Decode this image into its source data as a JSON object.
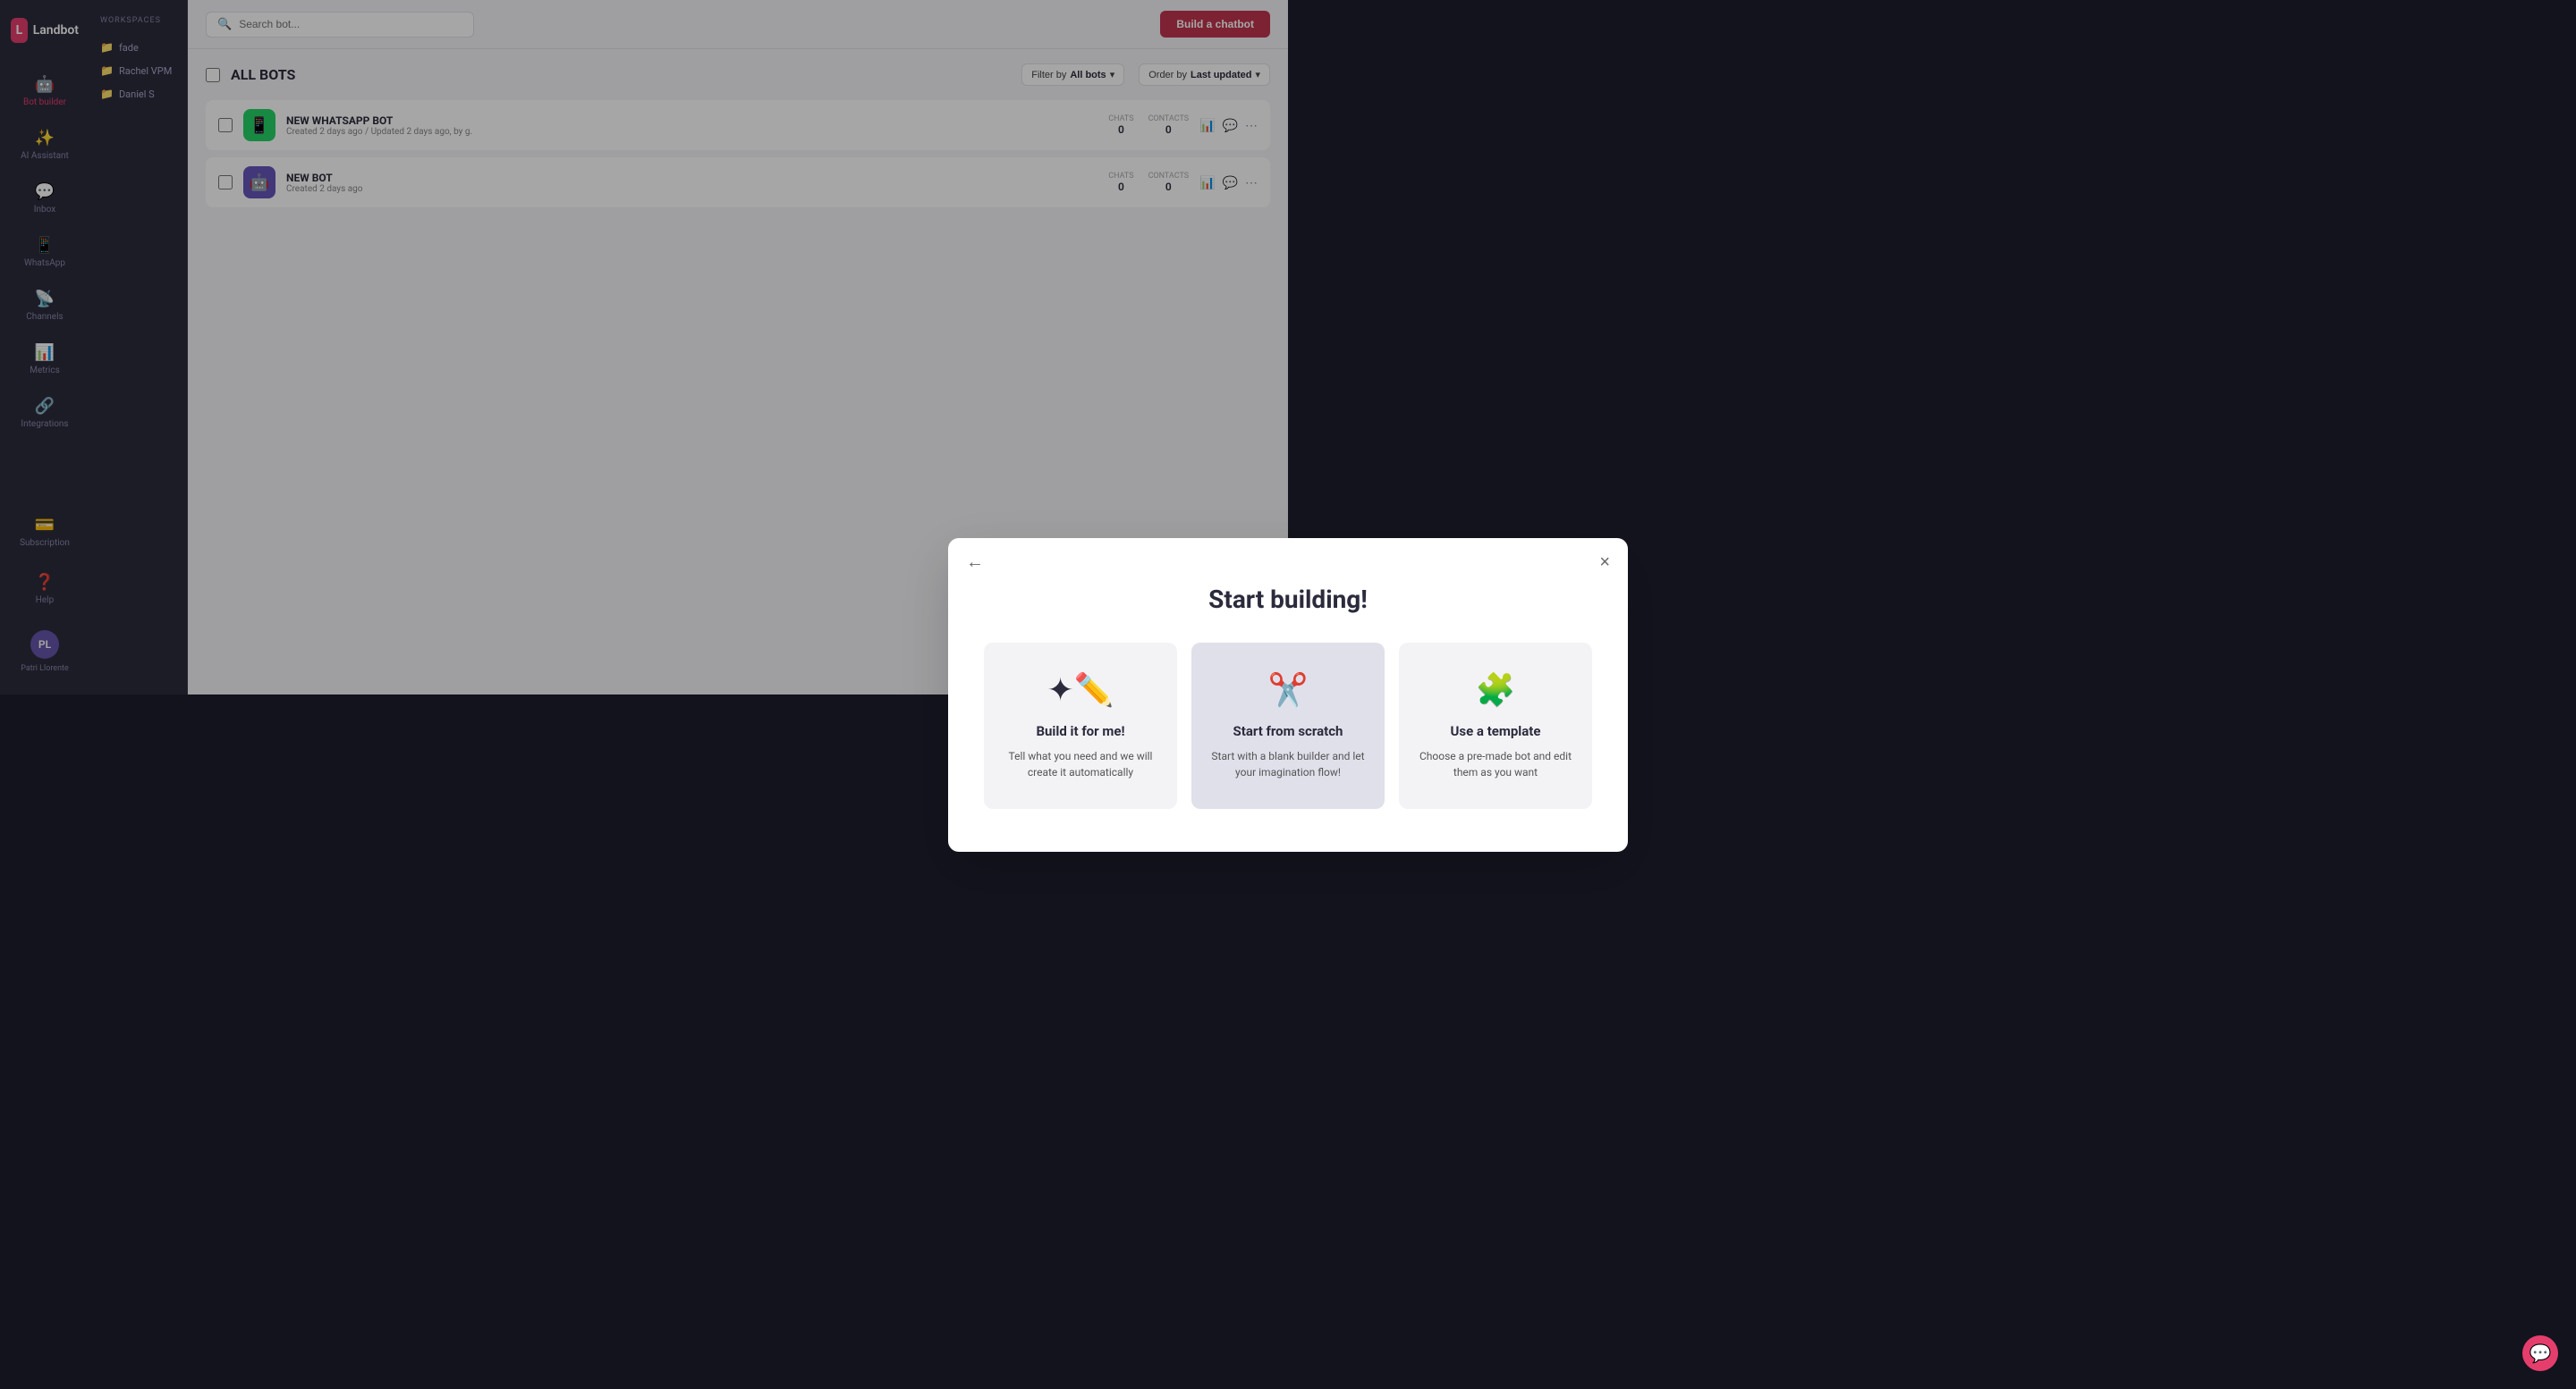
{
  "app": {
    "name": "Landbot"
  },
  "sidebar": {
    "logo_letter": "L",
    "items": [
      {
        "id": "bot-builder",
        "label": "Bot builder",
        "icon": "🤖",
        "active": true
      },
      {
        "id": "ai-assistant",
        "label": "AI Assistant",
        "icon": "✨"
      },
      {
        "id": "inbox",
        "label": "Inbox",
        "icon": "💬"
      },
      {
        "id": "whatsapp",
        "label": "WhatsApp",
        "icon": "📱"
      },
      {
        "id": "channels",
        "label": "Channels",
        "icon": "📡"
      },
      {
        "id": "metrics",
        "label": "Metrics",
        "icon": "📊"
      },
      {
        "id": "integrations",
        "label": "Integrations",
        "icon": "🔗"
      }
    ],
    "bottom_items": [
      {
        "id": "subscription",
        "label": "Subscription",
        "icon": "💳"
      },
      {
        "id": "help",
        "label": "Help",
        "icon": "❓"
      }
    ],
    "user": {
      "initials": "PL",
      "name": "Patri Llorente"
    }
  },
  "workspace": {
    "title": "WORKSPACES",
    "items": [
      {
        "name": "fade"
      },
      {
        "name": "Rachel VPM"
      },
      {
        "name": "Daniel S"
      }
    ]
  },
  "topbar": {
    "search_placeholder": "Search bot...",
    "build_btn_label": "Build a chatbot"
  },
  "bots_area": {
    "title": "ALL BOTS",
    "filter_label": "Filter by",
    "filter_value": "All bots",
    "order_label": "Order by",
    "order_value": "Last updated",
    "bot_rows": [
      {
        "name": "NEW WHATSAPP BOT",
        "meta": "Created 2 days ago / Updated 2 days ago, by g.",
        "chats": "0",
        "contacts": "0",
        "icon_type": "whatsapp"
      },
      {
        "name": "NEW BOT",
        "meta": "Created 2 days ago",
        "chats": "0",
        "contacts": "0",
        "icon_type": "bot"
      }
    ]
  },
  "modal": {
    "back_label": "←",
    "close_label": "×",
    "title": "Start building!",
    "cards": [
      {
        "id": "build-for-me",
        "icon": "✦",
        "icon_secondary": "✏️",
        "title": "Build it for me!",
        "desc": "Tell what you need and we will create it automatically",
        "active": false
      },
      {
        "id": "from-scratch",
        "icon": "✂️",
        "title": "Start from scratch",
        "desc": "Start with a blank builder and let your imagination flow!",
        "active": true
      },
      {
        "id": "use-template",
        "icon": "🧩",
        "title": "Use a template",
        "desc": "Choose a pre-made bot and edit them as you want",
        "active": false
      }
    ]
  }
}
